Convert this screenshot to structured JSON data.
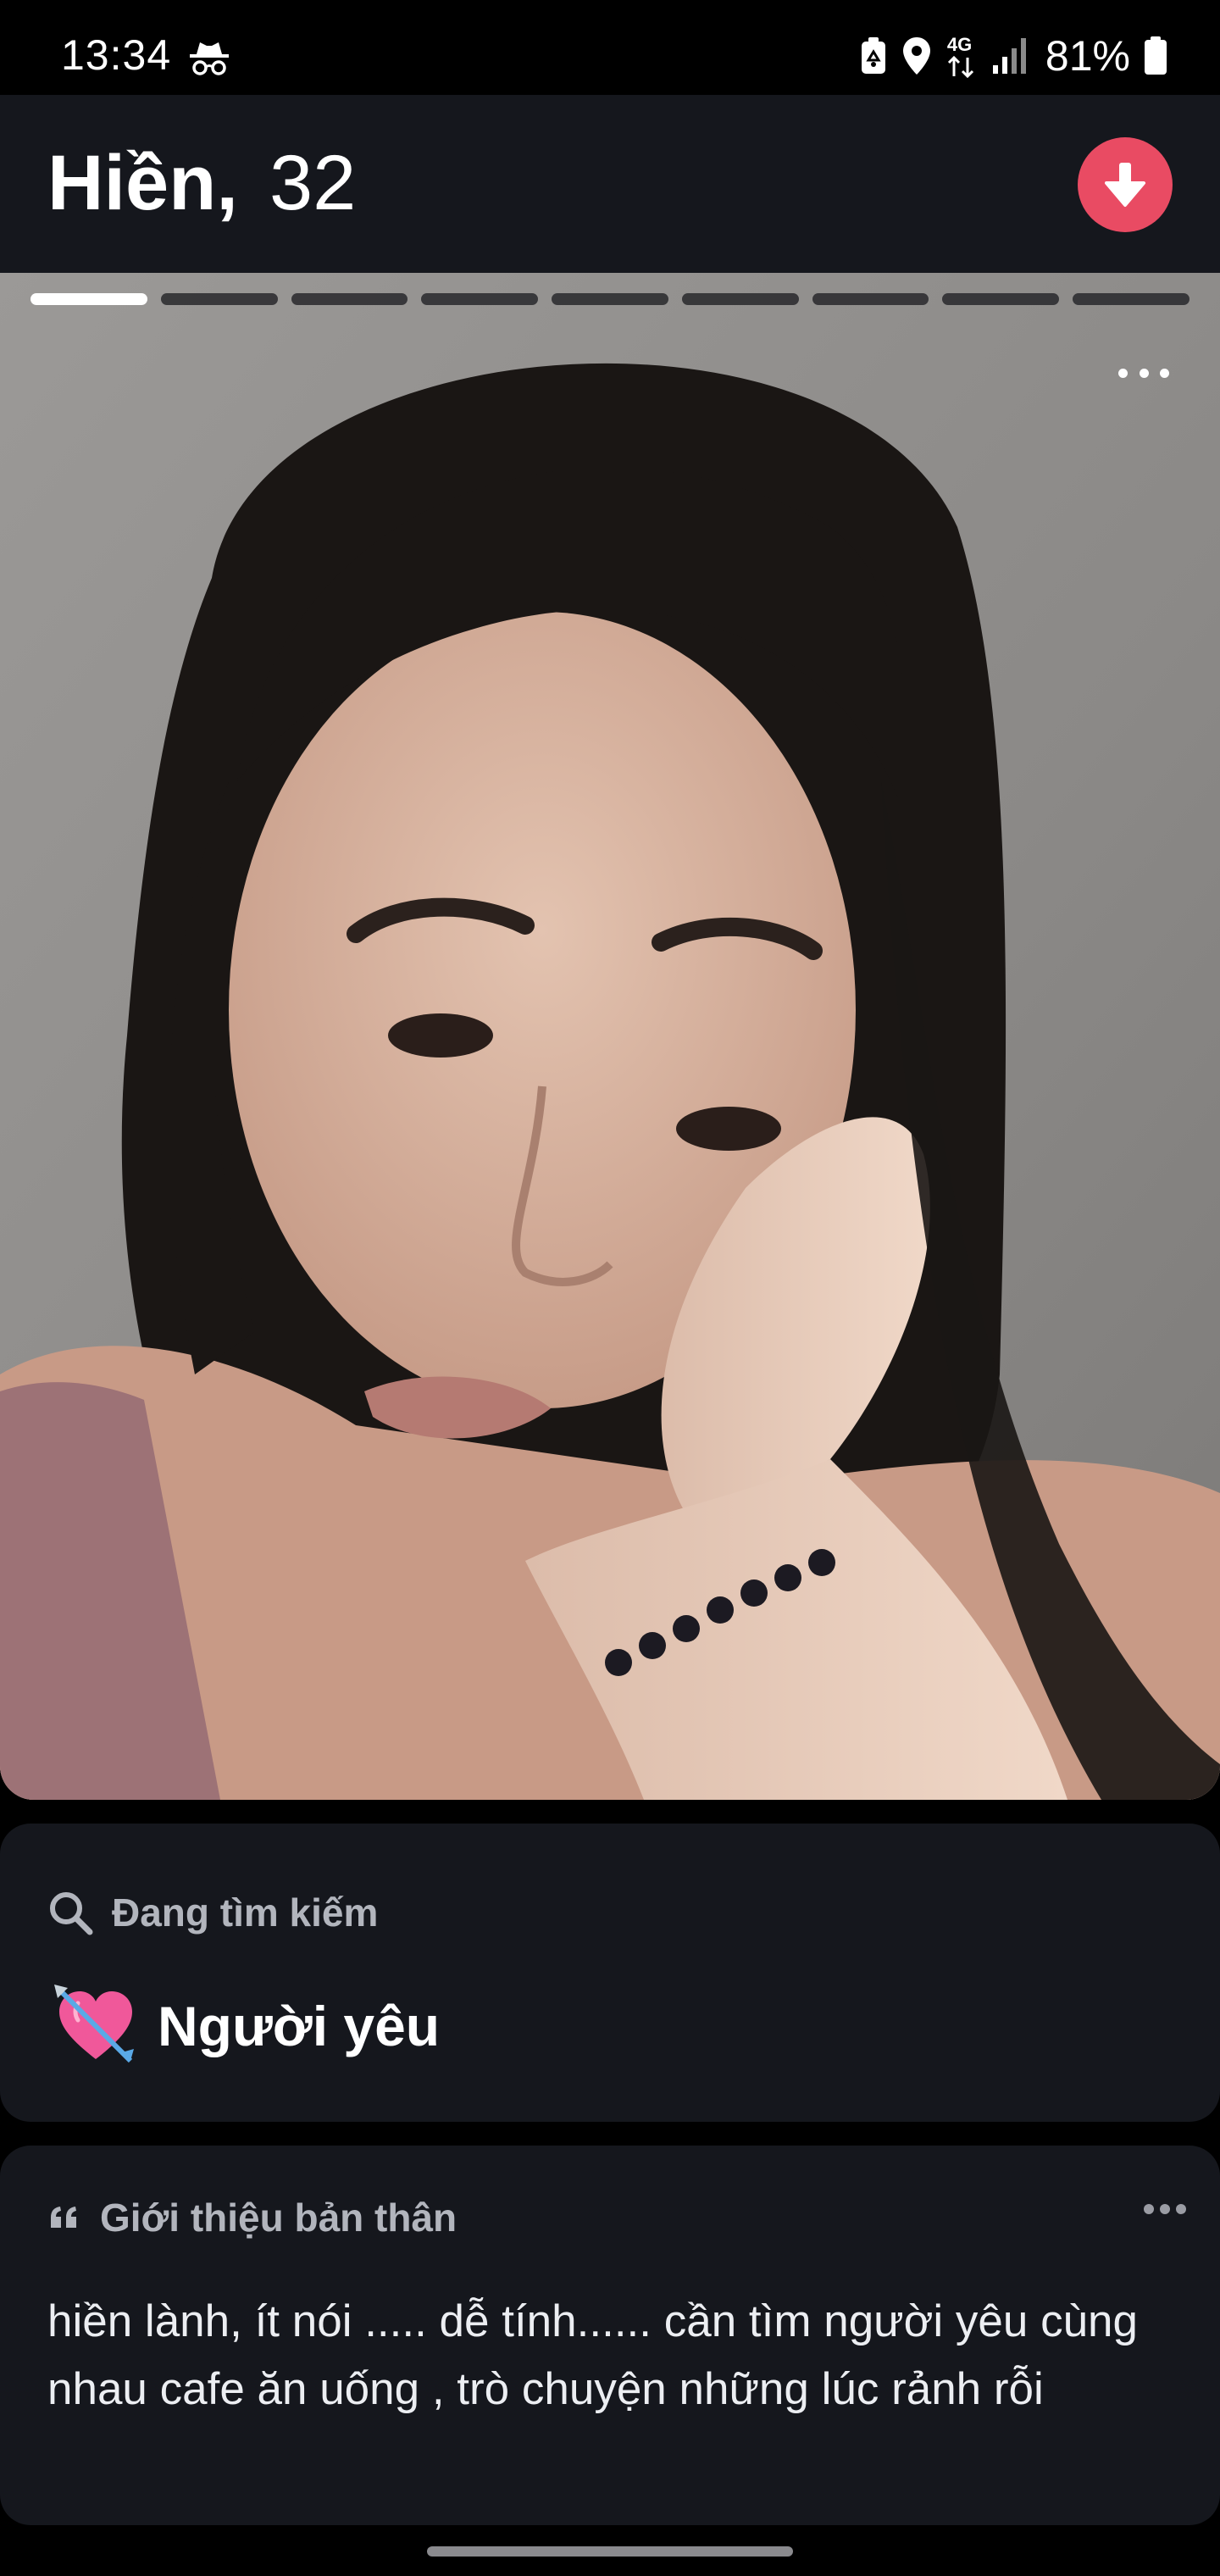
{
  "status_bar": {
    "time": "13:34",
    "network": "4G",
    "battery": "81%",
    "icons": [
      "incognito-icon",
      "battery-saver-icon",
      "location-icon",
      "network-4g-icon",
      "signal-icon",
      "battery-icon"
    ]
  },
  "profile": {
    "name": "Hiền,",
    "age": "32"
  },
  "colors": {
    "header_bg": "#15171d",
    "accent": "#e94b63",
    "card_bg": "#15171d",
    "muted_text": "#b2b5bd"
  },
  "photos": {
    "count": 9,
    "active_index": 0
  },
  "looking_for": {
    "label": "Đang tìm kiếm",
    "emoji": "heart-with-arrow-icon",
    "value": "Người yêu"
  },
  "about": {
    "label": "Giới thiệu bản thân",
    "text": "hiền lành, ít nói ..... dễ tính......  cần tìm người yêu cùng nhau cafe ăn uống , trò chuyện những lúc rảnh rỗi"
  }
}
